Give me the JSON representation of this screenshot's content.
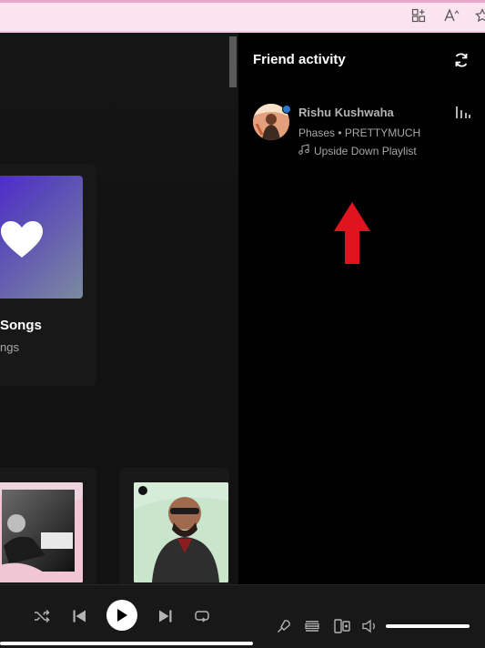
{
  "friend_activity": {
    "title": "Friend activity",
    "friend": {
      "name": "Rishu Kushwaha",
      "track": "Phases • PRETTYMUCH",
      "playlist": "Upside Down Playlist",
      "online": true
    }
  },
  "library": {
    "liked_title": "Songs",
    "liked_sub": "ngs"
  },
  "player": {
    "progress": 1.0,
    "volume": 1.0
  },
  "icons": {
    "browser": [
      "extensions-icon",
      "read-aloud-icon",
      "favorite-star-icon"
    ],
    "player": [
      "shuffle-icon",
      "previous-icon",
      "play-icon",
      "next-icon",
      "repeat-icon",
      "microphone-icon",
      "queue-icon",
      "connect-device-icon",
      "volume-icon"
    ]
  },
  "colors": {
    "background": "#000000",
    "panel": "#121212",
    "online_dot": "#2e77d0",
    "annotation_arrow": "#e0141e",
    "chrome": "#fbe4ef"
  }
}
